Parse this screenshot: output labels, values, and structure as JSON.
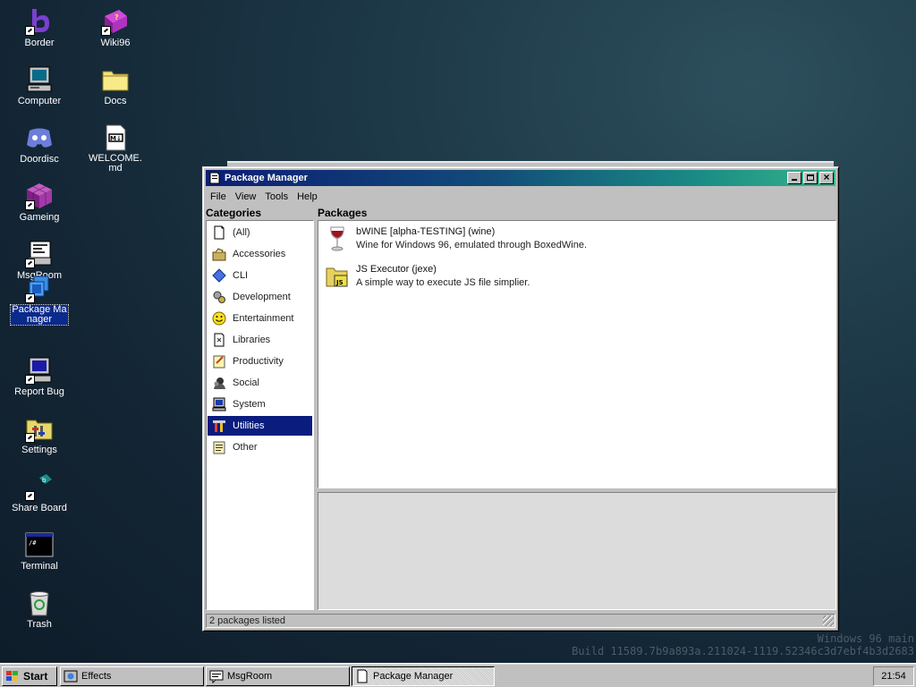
{
  "desktop": {
    "icons": [
      {
        "label": "Border",
        "icon": "border-app-icon"
      },
      {
        "label": "Wiki96",
        "icon": "wiki-book-icon"
      },
      {
        "label": "Computer",
        "icon": "computer-icon"
      },
      {
        "label": "Docs",
        "icon": "folder-icon"
      },
      {
        "label": "Doordisc",
        "icon": "doordisc-icon"
      },
      {
        "label": "WELCOME.md",
        "icon": "markdown-file-icon"
      },
      {
        "label": "Gameing",
        "icon": "game-cube-icon"
      },
      {
        "label": "MsgRoom",
        "icon": "msgroom-icon"
      },
      {
        "label": "Package Manager",
        "icon": "package-manager-icon"
      },
      {
        "label": "Report Bug",
        "icon": "report-bug-icon"
      },
      {
        "label": "Settings",
        "icon": "settings-icon"
      },
      {
        "label": "Share Board",
        "icon": "share-board-icon"
      },
      {
        "label": "Terminal",
        "icon": "terminal-icon"
      },
      {
        "label": "Trash",
        "icon": "trash-icon"
      }
    ]
  },
  "window": {
    "title": "Package Manager",
    "menu": [
      "File",
      "View",
      "Tools",
      "Help"
    ],
    "categories_label": "Categories",
    "packages_label": "Packages",
    "categories": [
      {
        "label": "(All)",
        "icon": "all-icon"
      },
      {
        "label": "Accessories",
        "icon": "accessories-icon"
      },
      {
        "label": "CLI",
        "icon": "cli-diamond-icon"
      },
      {
        "label": "Development",
        "icon": "development-icon"
      },
      {
        "label": "Entertainment",
        "icon": "smiley-icon"
      },
      {
        "label": "Libraries",
        "icon": "libraries-icon"
      },
      {
        "label": "Productivity",
        "icon": "productivity-icon"
      },
      {
        "label": "Social",
        "icon": "social-icon"
      },
      {
        "label": "System",
        "icon": "system-icon"
      },
      {
        "label": "Utilities",
        "icon": "utilities-icon",
        "selected": true
      },
      {
        "label": "Other",
        "icon": "other-icon"
      }
    ],
    "packages": [
      {
        "title": "bWINE [alpha-TESTING] (wine)",
        "description": "Wine for Windows 96, emulated through BoxedWine.",
        "icon": "wine-glass-icon"
      },
      {
        "title": "JS Executor (jexe)",
        "description": "A simple way to execute JS file simplier.",
        "icon": "js-folder-icon"
      }
    ],
    "status": "2 packages listed"
  },
  "watermark": {
    "line1": "Windows 96 main",
    "line2": "Build 11589.7b9a893a.211024-1119.52346c3d7ebf4b3d2683"
  },
  "taskbar": {
    "start_label": "Start",
    "tasks": [
      {
        "label": "Effects",
        "icon": "effects-icon",
        "active": false
      },
      {
        "label": "MsgRoom",
        "icon": "msgroom-icon",
        "active": false
      },
      {
        "label": "Package Manager",
        "icon": "package-manager-icon",
        "active": true
      }
    ],
    "clock": "21:54"
  },
  "colors": {
    "desktop_bg": "#132534",
    "titlebar_start": "#0c1e75",
    "titlebar_end": "#36b38a",
    "selection": "#0a1d7e"
  }
}
